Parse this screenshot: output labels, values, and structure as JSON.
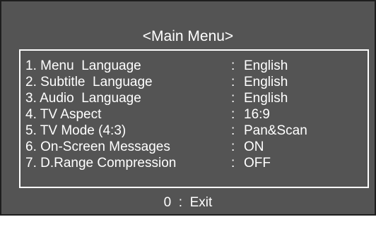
{
  "title": "<Main Menu>",
  "menu": {
    "items": [
      {
        "label": "1. Menu  Language",
        "sep": ":",
        "value": "English"
      },
      {
        "label": "2. Subtitle  Language",
        "sep": ":",
        "value": "English"
      },
      {
        "label": "3. Audio  Language",
        "sep": ":",
        "value": "English"
      },
      {
        "label": "4. TV Aspect",
        "sep": ":",
        "value": "16:9"
      },
      {
        "label": "5. TV Mode (4:3)",
        "sep": ":",
        "value": "Pan&Scan"
      },
      {
        "label": "6. On-Screen Messages",
        "sep": ":",
        "value": "ON"
      },
      {
        "label": "7. D.Range Compression",
        "sep": ":",
        "value": "OFF"
      }
    ]
  },
  "footer": {
    "exit_label": "0  :  Exit"
  },
  "colors": {
    "background": "#545454",
    "text": "#ffffff",
    "border": "#ffffff"
  }
}
